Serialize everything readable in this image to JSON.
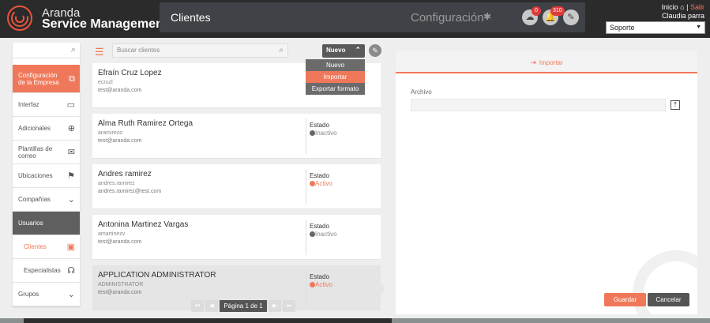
{
  "colors": {
    "accent": "#f0785a",
    "topbar": "#2b2b2b",
    "module_bar": "#3f4246",
    "badge": "#e03a3a"
  },
  "brand": {
    "line1": "Aranda",
    "line2": "Service Management"
  },
  "header": {
    "module_title": "Clientes",
    "section": "Configuración",
    "cloud_badge": "0",
    "bell_badge": "310",
    "inicio": "Inicio",
    "separator": "|",
    "salir": "Salir",
    "user_name": "Claudia parra",
    "project_select": "Soporte"
  },
  "sidebar": {
    "items": [
      {
        "label": "Configuración de la Empresa",
        "icon": "copy-icon"
      },
      {
        "label": "Interfaz",
        "icon": "monitor-icon"
      },
      {
        "label": "Adicionales",
        "icon": "plus-circle-icon"
      },
      {
        "label": "Plantillas de correo",
        "icon": "mail-icon"
      },
      {
        "label": "Ubicaciones",
        "icon": "signpost-icon"
      },
      {
        "label": "Compañías",
        "icon": "chevron-down-icon"
      },
      {
        "label": "Usuarios"
      },
      {
        "label": "Clientes",
        "icon": "user-card-icon"
      },
      {
        "label": "Especialistas",
        "icon": "headset-icon"
      },
      {
        "label": "Grupos",
        "icon": "chevron-down-icon"
      }
    ]
  },
  "list": {
    "search_placeholder": "Buscar clientes",
    "new_button": "Nuevo",
    "dropdown": [
      "Nuevo",
      "Importar",
      "Exportar formato"
    ],
    "estado_label": "Estado",
    "clients": [
      {
        "name": "Efraín Cruz Lopez",
        "user": "ecruzl",
        "email": "test@aranda.com",
        "status": ""
      },
      {
        "name": "Alma Ruth Ramirez Ortega",
        "user": "aramirezo",
        "email": "test@aranda.com",
        "status": "Inactivo"
      },
      {
        "name": "Andres ramirez",
        "user": "andres.ramirez",
        "email": "andres.ramirez@test.com",
        "status": "Activo"
      },
      {
        "name": "Antonina Martinez Vargas",
        "user": "amartinezv",
        "email": "test@aranda.com",
        "status": "Inactivo"
      },
      {
        "name": "APPLICATION ADMINISTRATOR",
        "user": "ADMINISTRATOR",
        "email": "test@aranda.com",
        "status": "Activo"
      }
    ],
    "pagination": {
      "first": "⏮",
      "prev": "◀",
      "label": "Página 1 de 1",
      "next": "▶",
      "last": "⏭"
    }
  },
  "panel": {
    "tab_label": "Importar",
    "file_label": "Archivo",
    "save": "Guardar",
    "cancel": "Cancelar"
  }
}
